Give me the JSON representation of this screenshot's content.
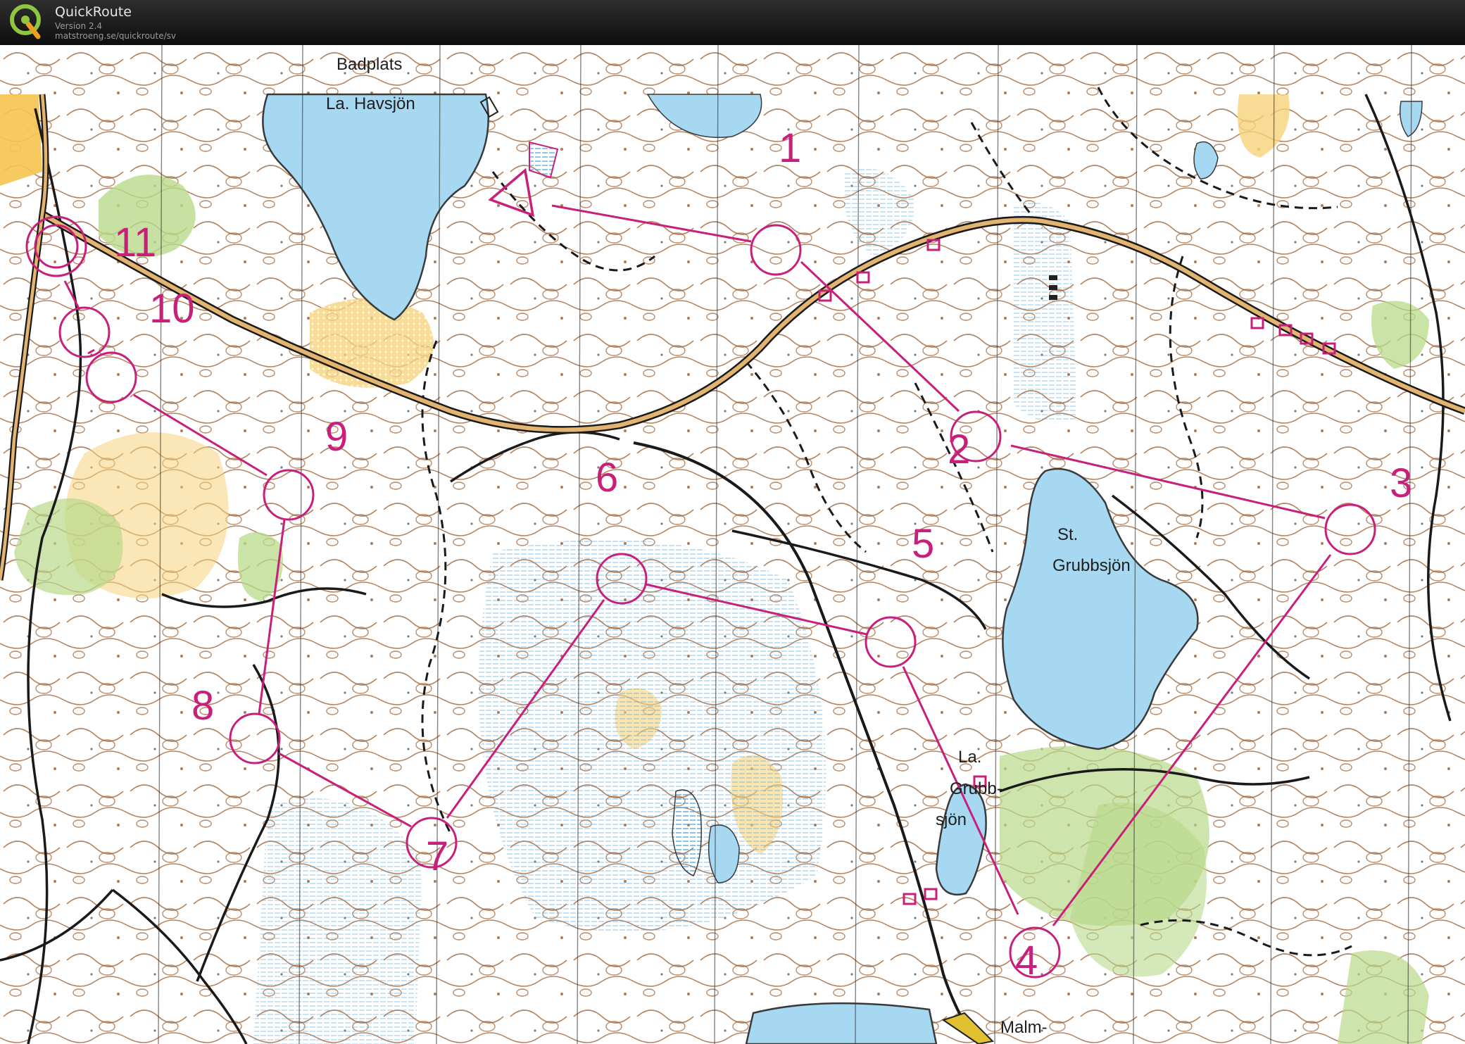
{
  "app": {
    "title": "QuickRoute",
    "version": "Version 2.4",
    "url": "matstroeng.se/quickroute/sv",
    "logo_letter": "Q",
    "logo_icon": "quickroute-logo-icon"
  },
  "colors": {
    "course": "#c8207a",
    "water": "#a6d8f2",
    "water_edge": "#3a3a3a",
    "contour": "#9a5a2a",
    "yellow_open": "#f6d27a",
    "green_veg": "#b8d98a",
    "track": "#1a1a1a",
    "road": "#d9a75a"
  },
  "map": {
    "place_names": [
      {
        "id": "badplats",
        "text": "Badplats"
      },
      {
        "id": "havsjon",
        "text": "La. Havsjön"
      },
      {
        "id": "st",
        "text": "St."
      },
      {
        "id": "grubbsjon",
        "text": "Grubbsjön"
      },
      {
        "id": "la",
        "text": "La."
      },
      {
        "id": "grubb",
        "text": "Grubb-"
      },
      {
        "id": "sjon",
        "text": "sjön"
      },
      {
        "id": "malm",
        "text": "Malm-"
      }
    ],
    "course": {
      "start": "start-triangle",
      "controls": [
        {
          "number": "1"
        },
        {
          "number": "2"
        },
        {
          "number": "3"
        },
        {
          "number": "4"
        },
        {
          "number": "5"
        },
        {
          "number": "6"
        },
        {
          "number": "7"
        },
        {
          "number": "8"
        },
        {
          "number": "9"
        },
        {
          "number": "10"
        },
        {
          "number": "11"
        }
      ],
      "finish": "finish-double-circle"
    }
  }
}
